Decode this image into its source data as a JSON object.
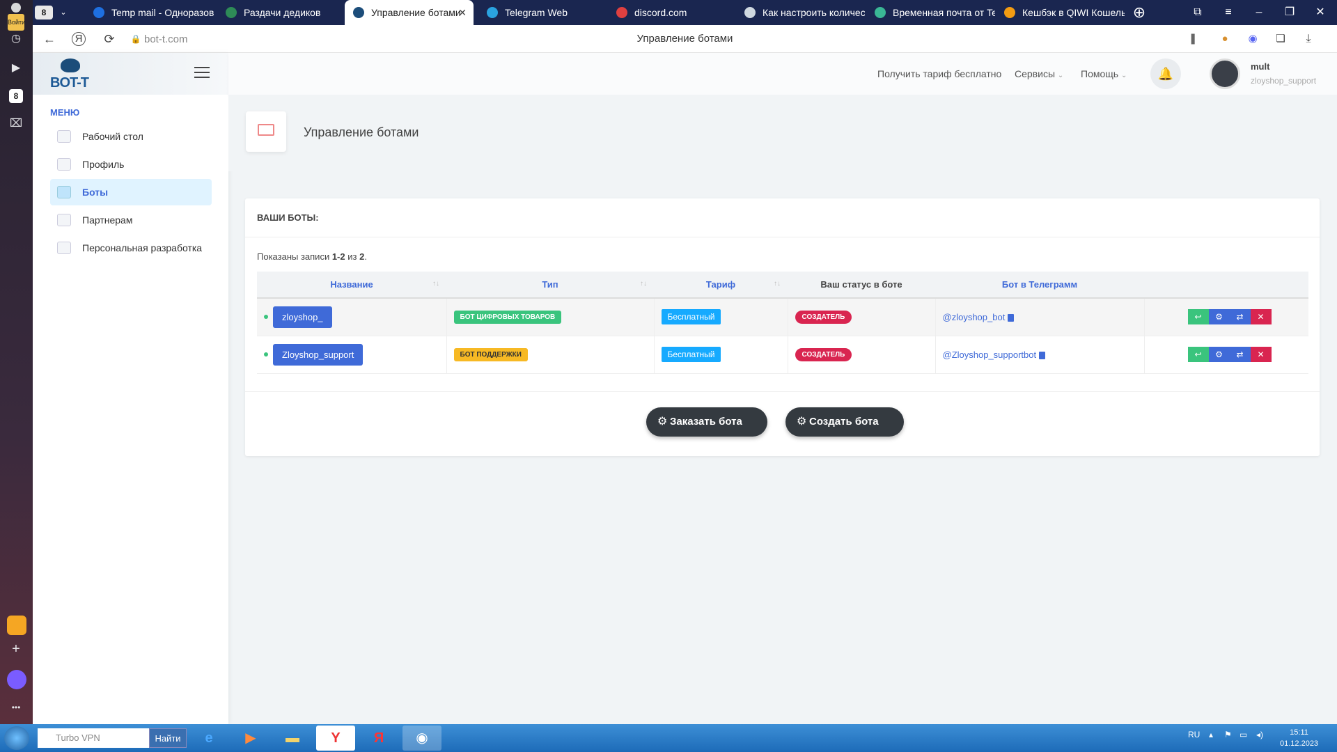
{
  "browser": {
    "login_label": "Войти",
    "tab_counter": "8",
    "tabs": [
      {
        "label": "Temp mail - Одноразов",
        "color": "#1e6fe0"
      },
      {
        "label": "Раздачи дедиков",
        "color": "#2e8b57"
      },
      {
        "label": "Управление ботами",
        "color": "#1c4d7a"
      },
      {
        "label": "Telegram Web",
        "color": "#2aa3e0"
      },
      {
        "label": "discord.com",
        "color": "#e04040"
      },
      {
        "label": "Как настроить количес",
        "color": "#cfd8e0"
      },
      {
        "label": "Временная почта от Te",
        "color": "#3ab795"
      },
      {
        "label": "Кешбэк в QIWI Кошель",
        "color": "#f39c12"
      }
    ],
    "active_tab_close": "✕",
    "url": "bot-t.com",
    "page_title": "Управление ботами"
  },
  "sidebar": {
    "logo_text": "BOT-T",
    "menu_title": "МЕНЮ",
    "items": [
      {
        "label": "Рабочий стол"
      },
      {
        "label": "Профиль"
      },
      {
        "label": "Боты"
      },
      {
        "label": "Партнерам"
      },
      {
        "label": "Персональная разработка"
      }
    ]
  },
  "header": {
    "free_tariff": "Получить тариф бесплатно",
    "services": "Сервисы",
    "help": "Помощь",
    "user_name": "mult",
    "user_login": "zloyshop_support"
  },
  "page": {
    "title": "Управление ботами",
    "card_title": "ВАШИ БОТЫ:",
    "summary_prefix": "Показаны записи ",
    "summary_range": "1-2",
    "summary_mid": " из ",
    "summary_total": "2",
    "summary_suffix": ".",
    "columns": {
      "name": "Название",
      "type": "Тип",
      "tariff": "Тариф",
      "status": "Ваш статус в боте",
      "telegram": "Бот в Телеграмм"
    },
    "rows": [
      {
        "name": "zloyshop_",
        "type": "БОТ ЦИФРОВЫХ ТОВАРОВ",
        "tariff": "Бесплатный",
        "status": "СОЗДАТЕЛЬ",
        "telegram": "@zloyshop_bot"
      },
      {
        "name": "Zloyshop_support",
        "type": "БОТ ПОДДЕРЖКИ",
        "tariff": "Бесплатный",
        "status": "СОЗДАТЕЛЬ",
        "telegram": "@Zloyshop_supportbot"
      }
    ],
    "order_button": "Заказать бота",
    "create_button": "Создать бота"
  },
  "taskbar": {
    "search_placeholder": "Turbo VPN",
    "search_button": "Найти",
    "lang": "RU",
    "time": "15:11",
    "date": "01.12.2023"
  },
  "icons": {
    "back": "←",
    "reload": "⟳",
    "bell": "🔔",
    "gear": "⚙",
    "reply": "↩",
    "repeat": "⇄",
    "delete": "✕"
  }
}
